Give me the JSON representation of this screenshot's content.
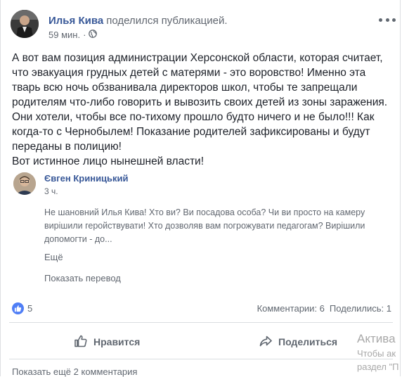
{
  "post": {
    "author": "Илья Кива",
    "action_text": "поделился публикацией.",
    "time": "59 мин.",
    "time_separator": "·",
    "lines": [
      "А вот вам позиция администрации Херсонской области, которая считает,",
      "что эвакуация грудных детей с матерями - это воровство! Именно эта",
      "тварь всю ночь обзванивала директоров школ, чтобы те запрещали",
      "родителям что-либо говорить и вывозить своих детей из зоны заражения.",
      "Они хотели, чтобы все по-тихому прошло будто ничего и не было!!! Как",
      "когда-то с Чернобылем! Показание родителей зафиксированы и будут",
      "переданы в полицию!",
      "Вот истинное лицо нынешней власти!"
    ]
  },
  "comment": {
    "author": "Євген Криницький",
    "time": "3 ч.",
    "lines": [
      "Не шановний Илья Кива! Хто ви? Ви посадова особа? Чи ви просто на камеру",
      "вирішили геройствувати! Хто дозволяв вам погрожувати педагогам? Вирішили",
      "допомогти - до..."
    ],
    "more_label": "Ещё",
    "translate_label": "Показать перевод"
  },
  "reactions": {
    "like_count": "5",
    "comments": "Комментарии: 6",
    "shares": "Поделились: 1",
    "like_color": "#4f7ef6"
  },
  "actions": {
    "like_label": "Нравится",
    "share_label": "Поделиться"
  },
  "footer": {
    "show_more_comments": "Показать ещё 2 комментария"
  },
  "watermark": {
    "line1": "Актива",
    "line2": "Чтобы ак",
    "line3": "раздел \"П"
  },
  "icons": {
    "menu": "more-horizontal-icon",
    "privacy": "globe-icon",
    "like": "thumbs-up-icon",
    "share": "share-arrow-icon"
  },
  "colors": {
    "link": "#385898",
    "meta": "#616770",
    "text": "#1d2129"
  }
}
